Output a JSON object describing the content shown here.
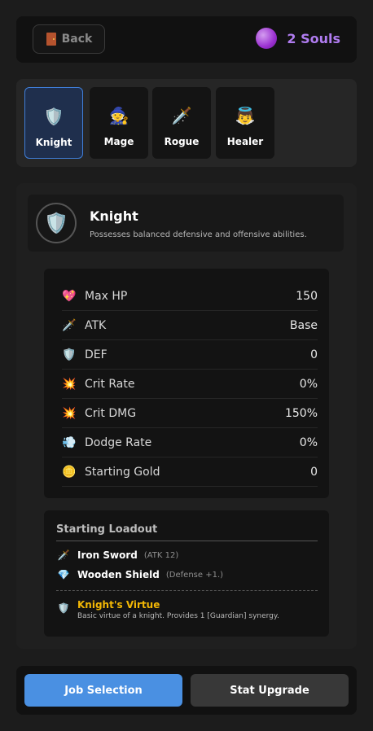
{
  "top_bar": {
    "back_label": "Back",
    "back_icon": "door-icon",
    "souls_icon": "purple-orb-icon",
    "souls_label": "2 Souls"
  },
  "jobs": [
    {
      "label": "Knight",
      "icon": "🛡️",
      "selected": true
    },
    {
      "label": "Mage",
      "icon": "🧙",
      "selected": false
    },
    {
      "label": "Rogue",
      "icon": "🗡️",
      "selected": false
    },
    {
      "label": "Healer",
      "icon": "👼",
      "selected": false
    }
  ],
  "class_info": {
    "icon": "🛡️",
    "name": "Knight",
    "description": "Possesses balanced defensive and offensive abilities."
  },
  "stats": [
    {
      "icon": "💖",
      "name": "Max HP",
      "value": "150"
    },
    {
      "icon": "🗡️",
      "name": "ATK",
      "value": "Base"
    },
    {
      "icon": "🛡️",
      "name": "DEF",
      "value": "0"
    },
    {
      "icon": "💥",
      "name": "Crit Rate",
      "value": "0%"
    },
    {
      "icon": "💥",
      "name": "Crit DMG",
      "value": "150%"
    },
    {
      "icon": "💨",
      "name": "Dodge Rate",
      "value": "0%"
    },
    {
      "icon": "🪙",
      "name": "Starting Gold",
      "value": "0"
    }
  ],
  "loadout": {
    "title": "Starting Loadout",
    "items": [
      {
        "icon": "🗡️",
        "name": "Iron Sword",
        "stat": "(ATK 12)"
      },
      {
        "icon": "💎",
        "name": "Wooden Shield",
        "stat": "(Defense +1.)"
      }
    ],
    "virtue": {
      "icon": "🛡️",
      "name": "Knight's Virtue",
      "description": "Basic virtue of a knight. Provides 1 [Guardian] synergy."
    }
  },
  "bottom_bar": {
    "job_selection_label": "Job Selection",
    "stat_upgrade_label": "Stat Upgrade"
  },
  "colors": {
    "accent_blue": "#4a90e2",
    "souls_purple": "#b07cf0",
    "virtue_gold": "#f2b705"
  }
}
